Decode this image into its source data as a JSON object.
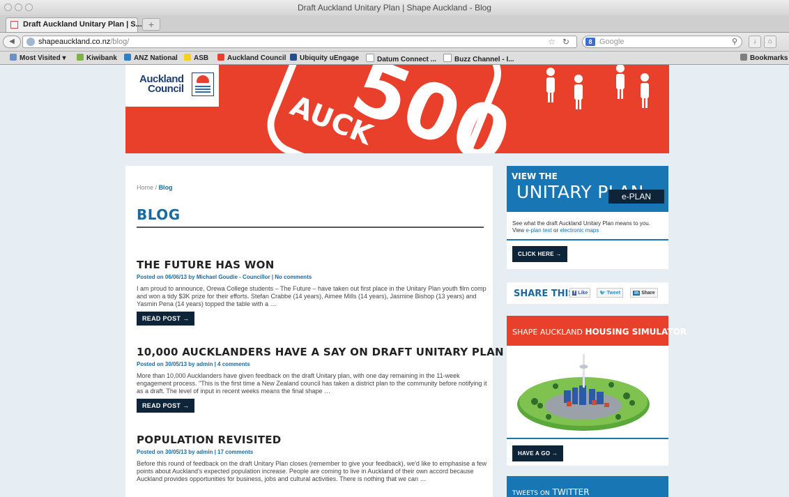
{
  "window": {
    "title": "Draft Auckland Unitary Plan | Shape Auckland - Blog"
  },
  "tab": {
    "label": "Draft Auckland Unitary Plan | S...",
    "new_tab": "+"
  },
  "address": {
    "domain": "shapeauckland.co.nz",
    "path": "/blog/"
  },
  "search": {
    "placeholder": "Google",
    "engine": "8"
  },
  "bookmarks": {
    "items": [
      "Most Visited",
      "Kiwibank",
      "ANZ National",
      "ASB",
      "Auckland Council",
      "Ubiquity uEngage",
      "Datum Connect ...",
      "Buzz Channel - I..."
    ],
    "right": "Bookmarks"
  },
  "logo": {
    "line1": "Auckland",
    "line2": "Council"
  },
  "breadcrumb": {
    "home": "Home",
    "sep": "/",
    "current": "Blog"
  },
  "page_title": "BLOG",
  "posts": [
    {
      "title": "THE FUTURE HAS WON",
      "meta": "Posted on 06/06/13 by Michael Goudie - Councillor  |  No comments",
      "body": "I am proud to announce, Orewa College students – The Future – have taken out first place in the Unitary Plan youth film comp and won a tidy $3K prize for their efforts. Stefan Crabbe (14 years), Aimee Mills (14 years), Jasmine Bishop (13 years) and Yasmin Pena (14 years) topped the table with a …",
      "button": "READ POST →"
    },
    {
      "title": "10,000 AUCKLANDERS HAVE A SAY ON DRAFT UNITARY PLAN",
      "meta": "Posted on 30/05/13 by admin  |  4 comments",
      "body": "More than 10,000 Aucklanders have given feedback on the draft Unitary plan, with one day remaining in the 11-week engagement process. \"This is the first time a New Zealand council has taken a district plan to the community before notifying it as a draft. The level of input in recent weeks means the final shape …",
      "button": "READ POST →"
    },
    {
      "title": "POPULATION REVISITED",
      "meta": "Posted on 30/05/13 by admin  |  17 comments",
      "body": "Before this round of feedback on the draft Unitary Plan closes (remember to give your feedback), we'd like to emphasise a few points about Auckland's expected population increase. People are coming to live in Auckland of their own accord because Auckland provides opportunities for business, jobs and cultural activities. There is nothing that we can …"
    }
  ],
  "eplan": {
    "view": "VIEW THE",
    "big": "UNITARY PLAN",
    "tag": "e-PLAN",
    "text_pre": "See what the draft Auckland Unitary Plan means to you. View ",
    "link1": "e-plan text",
    "or": " or ",
    "link2": "electronic maps",
    "button": "CLICK HERE →"
  },
  "share": {
    "title": "SHARE THIS",
    "like": "Like",
    "tweet": "Tweet",
    "share": "Share"
  },
  "simulator": {
    "prefix": "SHAPE AUCKLAND",
    "title": "HOUSING SIMULATOR",
    "button": "HAVE A GO →"
  },
  "twitter": {
    "prefix": "TWEETS ON",
    "title": "TWITTER"
  },
  "colors": {
    "brand_red": "#e8402b",
    "brand_blue": "#1876b5",
    "navy": "#0e2438"
  }
}
